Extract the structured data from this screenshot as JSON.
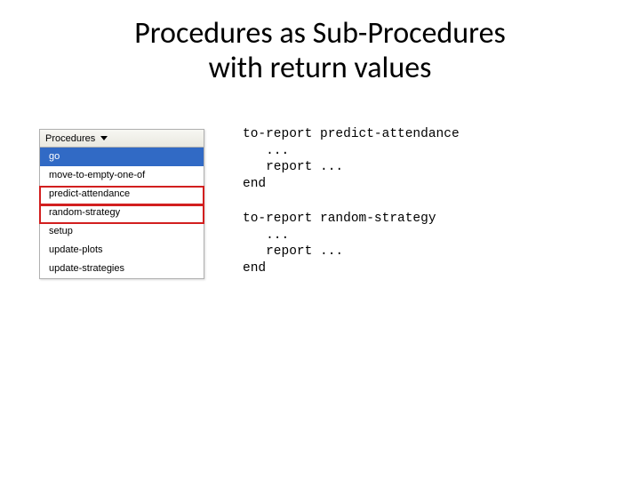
{
  "title_line1": "Procedures as Sub-Procedures",
  "title_line2": "with return values",
  "dropdown": {
    "header": "Procedures",
    "items": [
      "go",
      "move-to-empty-one-of",
      "predict-attendance",
      "random-strategy",
      "setup",
      "update-plots",
      "update-strategies"
    ]
  },
  "code1": "to-report predict-attendance\n   ...\n   report ...\nend",
  "code2": "to-report random-strategy\n   ...\n   report ...\nend"
}
